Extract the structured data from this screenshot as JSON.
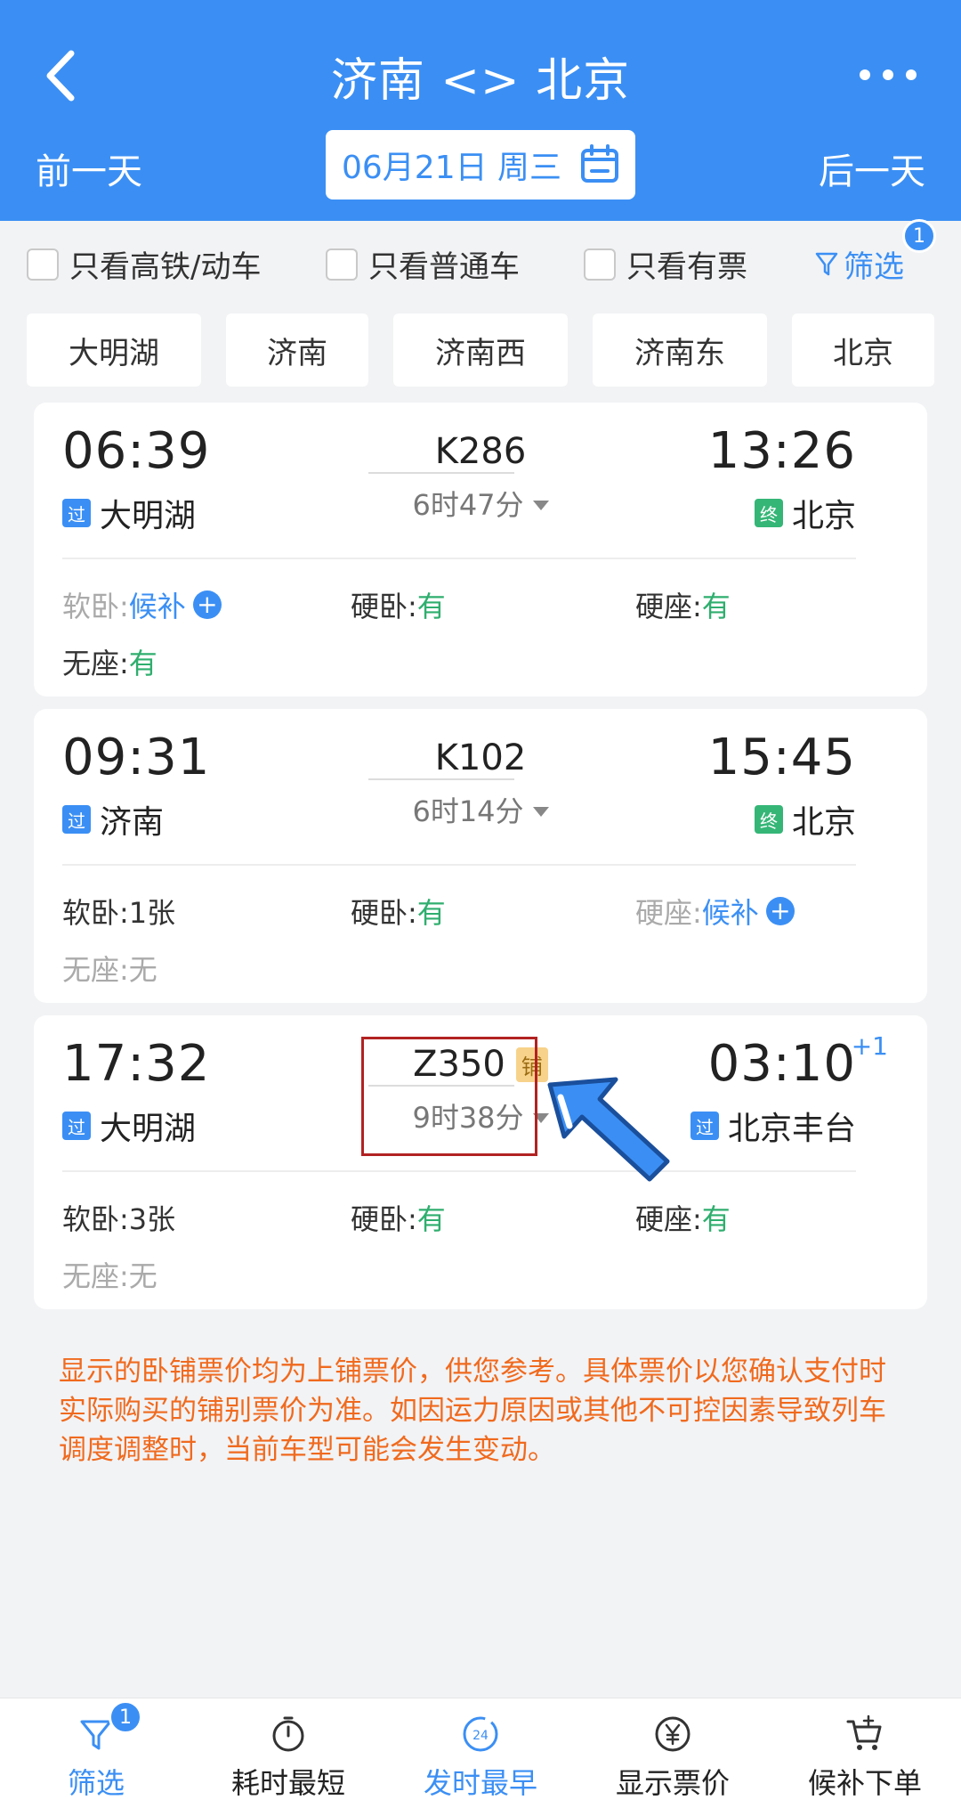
{
  "header": {
    "title": "济南 <> 北京",
    "prev_day": "前一天",
    "next_day": "后一天",
    "date": "06月21日 周三"
  },
  "filters": {
    "only_high_speed": "只看高铁/动车",
    "only_normal": "只看普通车",
    "only_available": "只看有票",
    "filter_label": "筛选",
    "filter_count": "1"
  },
  "stations": [
    "大明湖",
    "济南",
    "济南西",
    "济南东",
    "北京"
  ],
  "trains": [
    {
      "dep_time": "06:39",
      "arr_time": "13:26",
      "plus_day": "",
      "train_no": "K286",
      "badge": "",
      "duration": "6时47分",
      "dep_tag": "过",
      "dep_station": "大明湖",
      "arr_tag": "终",
      "arr_station": "北京",
      "seats": [
        {
          "label": "软卧: ",
          "value": "候补",
          "color": "blue",
          "plus": true,
          "dim": true
        },
        {
          "label": "硬卧: ",
          "value": "有",
          "color": "green",
          "plus": false,
          "dim": false
        },
        {
          "label": "硬座: ",
          "value": "有",
          "color": "green",
          "plus": false,
          "dim": false
        },
        {
          "label": "无座: ",
          "value": "有",
          "color": "green",
          "plus": false,
          "dim": false
        }
      ]
    },
    {
      "dep_time": "09:31",
      "arr_time": "15:45",
      "plus_day": "",
      "train_no": "K102",
      "badge": "",
      "duration": "6时14分",
      "dep_tag": "过",
      "dep_station": "济南",
      "arr_tag": "终",
      "arr_station": "北京",
      "seats": [
        {
          "label": "软卧: ",
          "value": "1张",
          "color": "",
          "plus": false,
          "dim": false
        },
        {
          "label": "硬卧: ",
          "value": "有",
          "color": "green",
          "plus": false,
          "dim": false
        },
        {
          "label": "硬座: ",
          "value": "候补",
          "color": "blue",
          "plus": true,
          "dim": true
        },
        {
          "label": "无座: ",
          "value": "无",
          "color": "gray",
          "plus": false,
          "dim": true
        }
      ]
    },
    {
      "dep_time": "17:32",
      "arr_time": "03:10",
      "plus_day": "+1",
      "train_no": "Z350",
      "badge": "铺",
      "duration": "9时38分",
      "dep_tag": "过",
      "dep_station": "大明湖",
      "arr_tag": "过",
      "arr_station": "北京丰台",
      "seats": [
        {
          "label": "软卧: ",
          "value": "3张",
          "color": "",
          "plus": false,
          "dim": false
        },
        {
          "label": "硬卧: ",
          "value": "有",
          "color": "green",
          "plus": false,
          "dim": false
        },
        {
          "label": "硬座: ",
          "value": "有",
          "color": "green",
          "plus": false,
          "dim": false
        },
        {
          "label": "无座: ",
          "value": "无",
          "color": "gray",
          "plus": false,
          "dim": true
        }
      ]
    }
  ],
  "notice": "显示的卧铺票价均为上铺票价，供您参考。具体票价以您确认支付时实际购买的铺别票价为准。如因运力原因或其他不可控因素导致列车调度调整时，当前车型可能会发生变动。",
  "bottom_bar": {
    "filter": "筛选",
    "filter_count": "1",
    "shortest": "耗时最短",
    "earliest": "发时最早",
    "earliest_icon_text": "24",
    "show_price": "显示票价",
    "waitlist": "候补下单"
  },
  "colors": {
    "primary": "#3b8ff4",
    "available": "#2fae6e",
    "notice": "#f06a1e",
    "highlight_box": "#b22222"
  }
}
